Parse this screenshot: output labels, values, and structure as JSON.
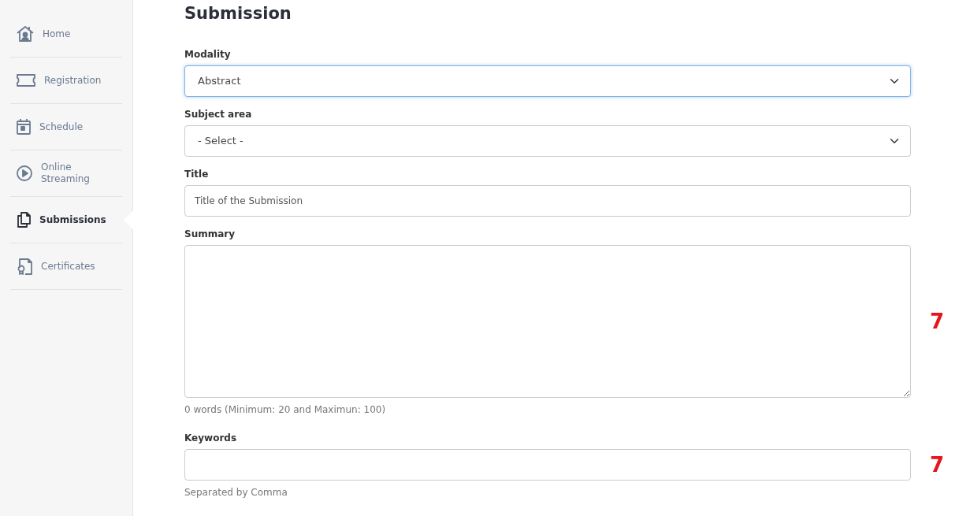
{
  "sidebar": {
    "items": [
      {
        "label": "Home",
        "selected": false
      },
      {
        "label": "Registration",
        "selected": false
      },
      {
        "label": "Schedule",
        "selected": false
      },
      {
        "label": "Online Streaming",
        "selected": false
      },
      {
        "label": "Submissions",
        "selected": true
      },
      {
        "label": "Certificates",
        "selected": false
      }
    ]
  },
  "heading": "Submission",
  "fields": [
    {
      "kind": "select",
      "label": "Modality",
      "value": "Abstract",
      "focused": true
    },
    {
      "kind": "select",
      "label": "Subject area",
      "value": "- Select -",
      "focused": false
    },
    {
      "kind": "input",
      "label": "Title",
      "placeholder": "Title of the Submission",
      "focused": false
    },
    {
      "kind": "textarea",
      "label": "Summary",
      "help": "0 words (Minimum: 20 and Maximun: 100)",
      "annotation": "7",
      "focused": false
    },
    {
      "kind": "input",
      "label": "Keywords",
      "help": "Separated by Comma",
      "annotation": "7",
      "focused": false
    }
  ]
}
